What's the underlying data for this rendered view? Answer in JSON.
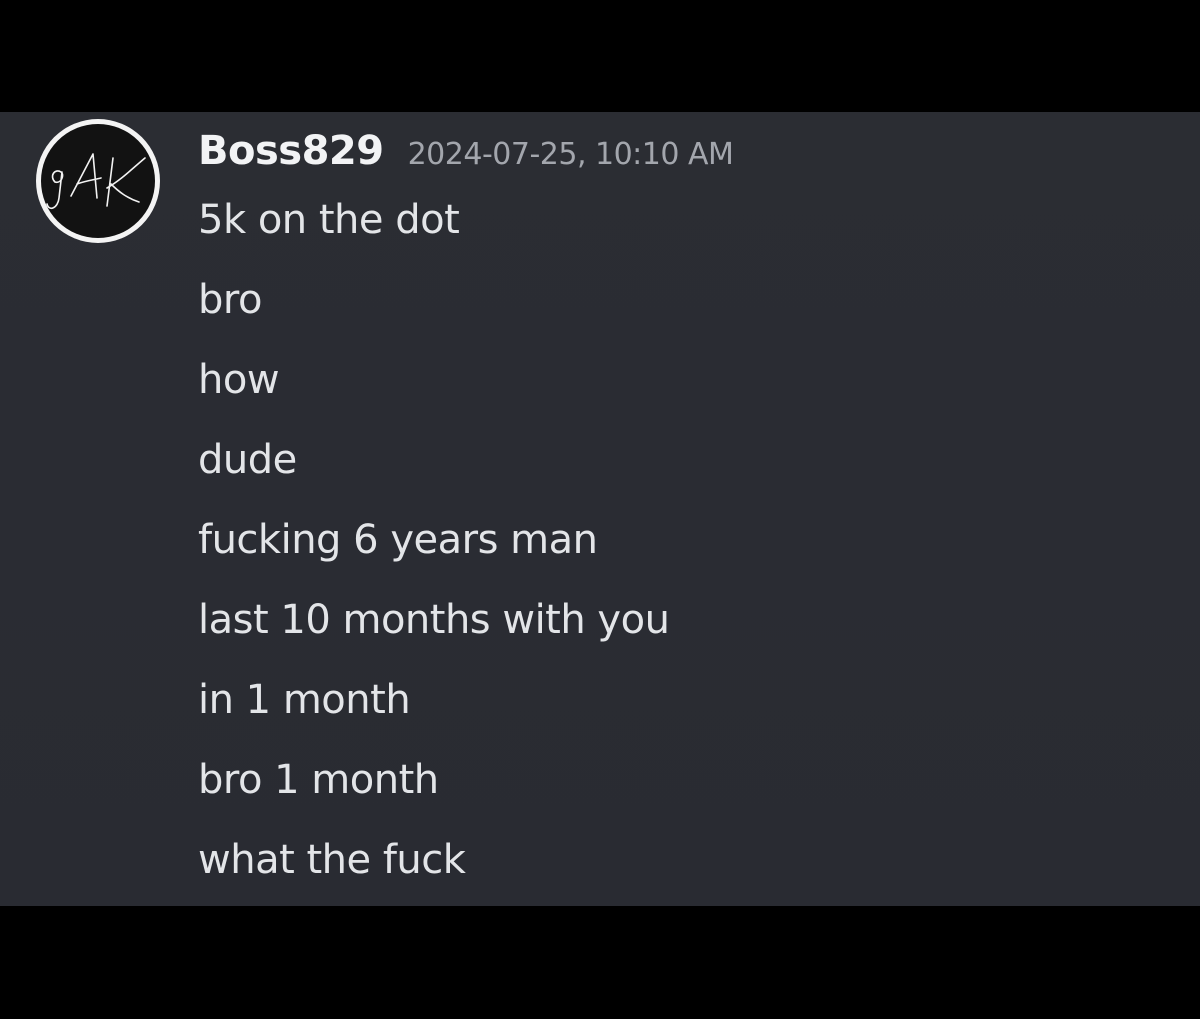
{
  "post": {
    "username": "Boss829",
    "timestamp": "2024-07-25, 10:10 AM",
    "avatar_icon": "gak-signature-avatar-icon",
    "avatar_monogram": "gAK"
  },
  "messages": [
    "5k on the dot",
    "bro",
    "how",
    "dude",
    "fucking 6 years man",
    "last 10 months with you",
    "in 1 month",
    "bro 1 month",
    "what the fuck"
  ],
  "colors": {
    "page_background": "#000000",
    "chat_background": "#2b2d33",
    "username": "#f2f3f5",
    "timestamp": "#a3a6ad",
    "message_text": "#e3e5e8",
    "avatar_ring": "#f4f4f4",
    "avatar_fill": "#121212"
  }
}
